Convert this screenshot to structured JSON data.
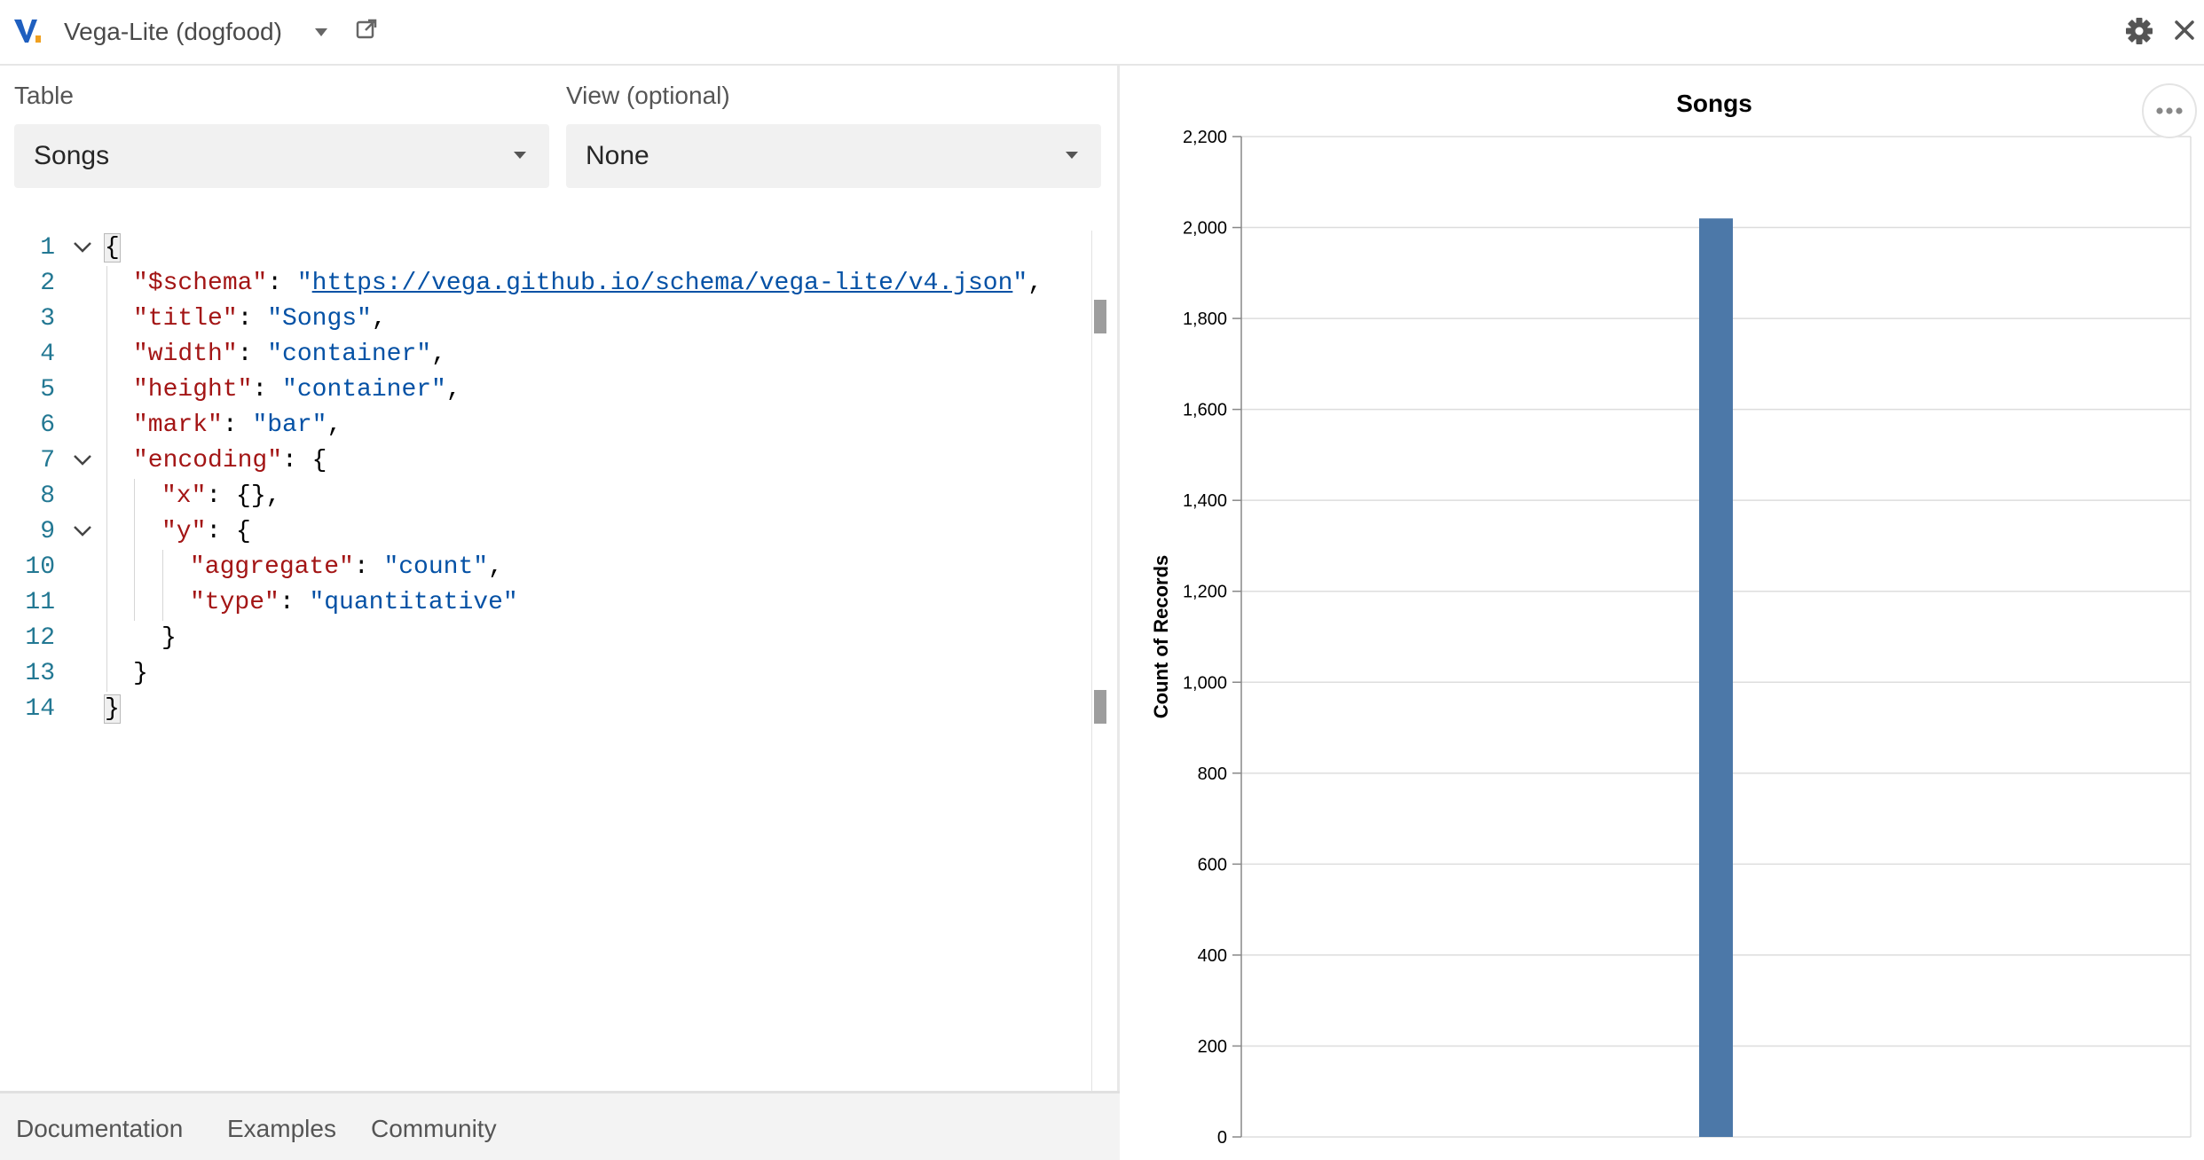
{
  "header": {
    "app_title": "Vega-Lite (dogfood)",
    "icons": [
      "vega-logo-icon",
      "chevron-down-icon",
      "popout-icon",
      "gear-icon",
      "close-icon"
    ]
  },
  "table_select": {
    "label": "Table",
    "value": "Songs"
  },
  "view_select": {
    "label": "View (optional)",
    "value": "None"
  },
  "editor": {
    "lines": [
      {
        "n": "1"
      },
      {
        "n": "2"
      },
      {
        "n": "3"
      },
      {
        "n": "4"
      },
      {
        "n": "5"
      },
      {
        "n": "6"
      },
      {
        "n": "7"
      },
      {
        "n": "8"
      },
      {
        "n": "9"
      },
      {
        "n": "10"
      },
      {
        "n": "11"
      },
      {
        "n": "12"
      },
      {
        "n": "13"
      },
      {
        "n": "14"
      }
    ],
    "tokens": {
      "open_brace": "{",
      "close_brace": "}",
      "schema_key": "\"$schema\"",
      "schema_q1": "\"",
      "schema_url": "https://vega.github.io/schema/vega-lite/v4.json",
      "schema_q2": "\"",
      "title_key": "\"title\"",
      "title_val": "\"Songs\"",
      "width_key": "\"width\"",
      "width_val": "\"container\"",
      "height_key": "\"height\"",
      "height_val": "\"container\"",
      "mark_key": "\"mark\"",
      "mark_val": "\"bar\"",
      "encoding_key": "\"encoding\"",
      "x_key": "\"x\"",
      "x_val": "{},",
      "y_key": "\"y\"",
      "aggregate_key": "\"aggregate\"",
      "aggregate_val": "\"count\"",
      "type_key": "\"type\"",
      "type_val": "\"quantitative\"",
      "colon": ": ",
      "comma": ",",
      "open_obj": "{"
    }
  },
  "footer": {
    "links": [
      "Documentation",
      "Examples",
      "Community"
    ]
  },
  "colors": {
    "bar": "#4c78a8",
    "accent_blue": "#0451a5",
    "json_key": "#a31515"
  },
  "chart_data": {
    "type": "bar",
    "title": "Songs",
    "xlabel": "",
    "ylabel": "Count of Records",
    "categories": [
      ""
    ],
    "values": [
      2020
    ],
    "ylim": [
      0,
      2200
    ],
    "yticks": [
      0,
      200,
      400,
      600,
      800,
      1000,
      1200,
      1400,
      1600,
      1800,
      2000,
      2200
    ],
    "ytick_labels": [
      "0",
      "200",
      "400",
      "600",
      "800",
      "1,000",
      "1,200",
      "1,400",
      "1,600",
      "1,800",
      "2,000",
      "2,200"
    ],
    "grid": true
  }
}
